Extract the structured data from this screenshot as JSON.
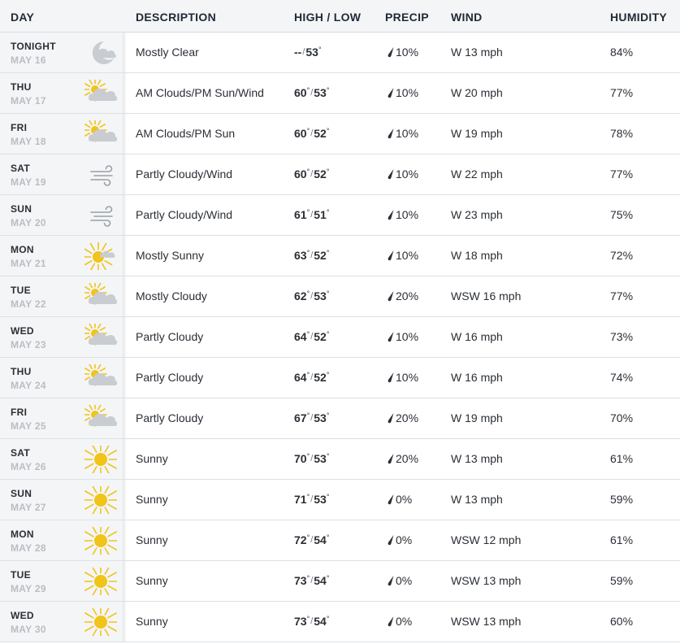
{
  "headers": {
    "day": "DAY",
    "description": "DESCRIPTION",
    "high_low": "HIGH / LOW",
    "precip": "PRECIP",
    "wind": "WIND",
    "humidity": "HUMIDITY"
  },
  "colors": {
    "sun": "#f0c419",
    "cloud": "#c9ccd1",
    "moon": "#c9ccd1",
    "wind_lines": "#9aa0a6",
    "date_gray": "#b9bec4",
    "panel_bg": "#f4f5f7"
  },
  "rows": [
    {
      "day": "TONIGHT",
      "date": "MAY 16",
      "icon": "moon-cloud-icon",
      "desc": "Mostly Clear",
      "hi": "--",
      "lo": "53",
      "precip": "10%",
      "wind": "W 13 mph",
      "humidity": "84%"
    },
    {
      "day": "THU",
      "date": "MAY 17",
      "icon": "sun-cloud-icon",
      "desc": "AM Clouds/PM Sun/Wind",
      "hi": "60",
      "lo": "53",
      "precip": "10%",
      "wind": "W 20 mph",
      "humidity": "77%"
    },
    {
      "day": "FRI",
      "date": "MAY 18",
      "icon": "sun-cloud-icon",
      "desc": "AM Clouds/PM Sun",
      "hi": "60",
      "lo": "52",
      "precip": "10%",
      "wind": "W 19 mph",
      "humidity": "78%"
    },
    {
      "day": "SAT",
      "date": "MAY 19",
      "icon": "wind-icon",
      "desc": "Partly Cloudy/Wind",
      "hi": "60",
      "lo": "52",
      "precip": "10%",
      "wind": "W 22 mph",
      "humidity": "77%"
    },
    {
      "day": "SUN",
      "date": "MAY 20",
      "icon": "wind-icon",
      "desc": "Partly Cloudy/Wind",
      "hi": "61",
      "lo": "51",
      "precip": "10%",
      "wind": "W 23 mph",
      "humidity": "75%"
    },
    {
      "day": "MON",
      "date": "MAY 21",
      "icon": "mostly-sunny-icon",
      "desc": "Mostly Sunny",
      "hi": "63",
      "lo": "52",
      "precip": "10%",
      "wind": "W 18 mph",
      "humidity": "72%"
    },
    {
      "day": "TUE",
      "date": "MAY 22",
      "icon": "sun-cloud-icon",
      "desc": "Mostly Cloudy",
      "hi": "62",
      "lo": "53",
      "precip": "20%",
      "wind": "WSW 16 mph",
      "humidity": "77%"
    },
    {
      "day": "WED",
      "date": "MAY 23",
      "icon": "sun-cloud-icon",
      "desc": "Partly Cloudy",
      "hi": "64",
      "lo": "52",
      "precip": "10%",
      "wind": "W 16 mph",
      "humidity": "73%"
    },
    {
      "day": "THU",
      "date": "MAY 24",
      "icon": "sun-cloud-icon",
      "desc": "Partly Cloudy",
      "hi": "64",
      "lo": "52",
      "precip": "10%",
      "wind": "W 16 mph",
      "humidity": "74%"
    },
    {
      "day": "FRI",
      "date": "MAY 25",
      "icon": "sun-cloud-icon",
      "desc": "Partly Cloudy",
      "hi": "67",
      "lo": "53",
      "precip": "20%",
      "wind": "W 19 mph",
      "humidity": "70%"
    },
    {
      "day": "SAT",
      "date": "MAY 26",
      "icon": "sun-icon",
      "desc": "Sunny",
      "hi": "70",
      "lo": "53",
      "precip": "20%",
      "wind": "W 13 mph",
      "humidity": "61%"
    },
    {
      "day": "SUN",
      "date": "MAY 27",
      "icon": "sun-icon",
      "desc": "Sunny",
      "hi": "71",
      "lo": "53",
      "precip": "0%",
      "wind": "W 13 mph",
      "humidity": "59%"
    },
    {
      "day": "MON",
      "date": "MAY 28",
      "icon": "sun-icon",
      "desc": "Sunny",
      "hi": "72",
      "lo": "54",
      "precip": "0%",
      "wind": "WSW 12 mph",
      "humidity": "61%"
    },
    {
      "day": "TUE",
      "date": "MAY 29",
      "icon": "sun-icon",
      "desc": "Sunny",
      "hi": "73",
      "lo": "54",
      "precip": "0%",
      "wind": "WSW 13 mph",
      "humidity": "59%"
    },
    {
      "day": "WED",
      "date": "MAY 30",
      "icon": "sun-icon",
      "desc": "Sunny",
      "hi": "73",
      "lo": "54",
      "precip": "0%",
      "wind": "WSW 13 mph",
      "humidity": "60%"
    }
  ]
}
